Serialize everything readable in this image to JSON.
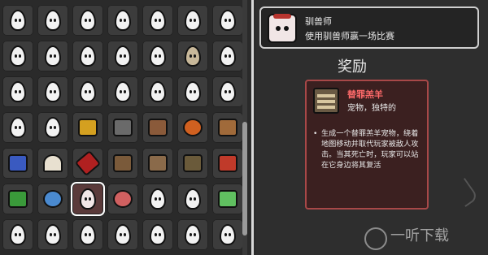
{
  "achievement": {
    "title": "驯兽师",
    "description": "使用驯兽师赢一场比赛"
  },
  "rewards": {
    "heading": "奖励",
    "item": {
      "name": "替罪羔羊",
      "tags": "宠物，独特的",
      "effect": "生成一个替罪羔羊宠物，绕着地图移动并取代玩家被敌人攻击。当其死亡时，玩家可以站在它身边将其复活"
    }
  },
  "watermark": {
    "text": "一听下载"
  },
  "colors": {
    "reward_name": "#ff6a6a",
    "reward_border": "#a84848",
    "panel_border": "#d8d8d8"
  }
}
